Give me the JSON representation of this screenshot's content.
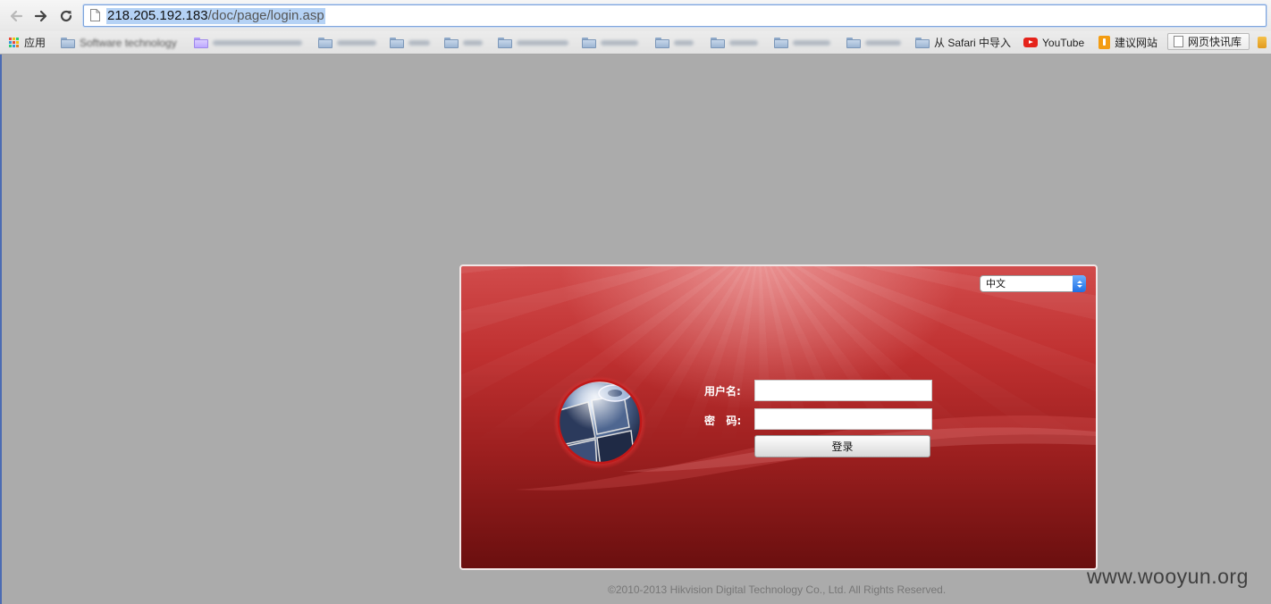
{
  "browser": {
    "url_host": "218.205.192.183",
    "url_path": "/doc/page/login.asp",
    "bookmarks": {
      "apps_label": "应用",
      "software_label": "Software technology",
      "safari_label": "从 Safari 中导入",
      "youtube_label": "YouTube",
      "suggest_label": "建议网站",
      "snapshot_label": "网页快讯库"
    }
  },
  "login": {
    "language_selected": "中文",
    "username_label": "用户名:",
    "password_label": "密   码:",
    "username_value": "",
    "password_value": "",
    "submit_label": "登录"
  },
  "footer": {
    "copyright": "©2010-2013 Hikvision Digital Technology Co., Ltd. All Rights Reserved."
  },
  "watermark": "www.wooyun.org",
  "colors": {
    "page_background": "#ababab",
    "panel_red": "#bf3030",
    "panel_dark_red": "#6a0f0f",
    "select_accent": "#1f6fe3"
  },
  "icons": {
    "back": "arrow-left-icon",
    "forward": "arrow-right-icon",
    "reload": "reload-icon",
    "page": "document-icon",
    "apps": "apps-grid-icon",
    "folder": "folder-icon",
    "youtube": "youtube-icon",
    "suggest": "suggest-icon",
    "logo": "camera-globe-logo"
  }
}
